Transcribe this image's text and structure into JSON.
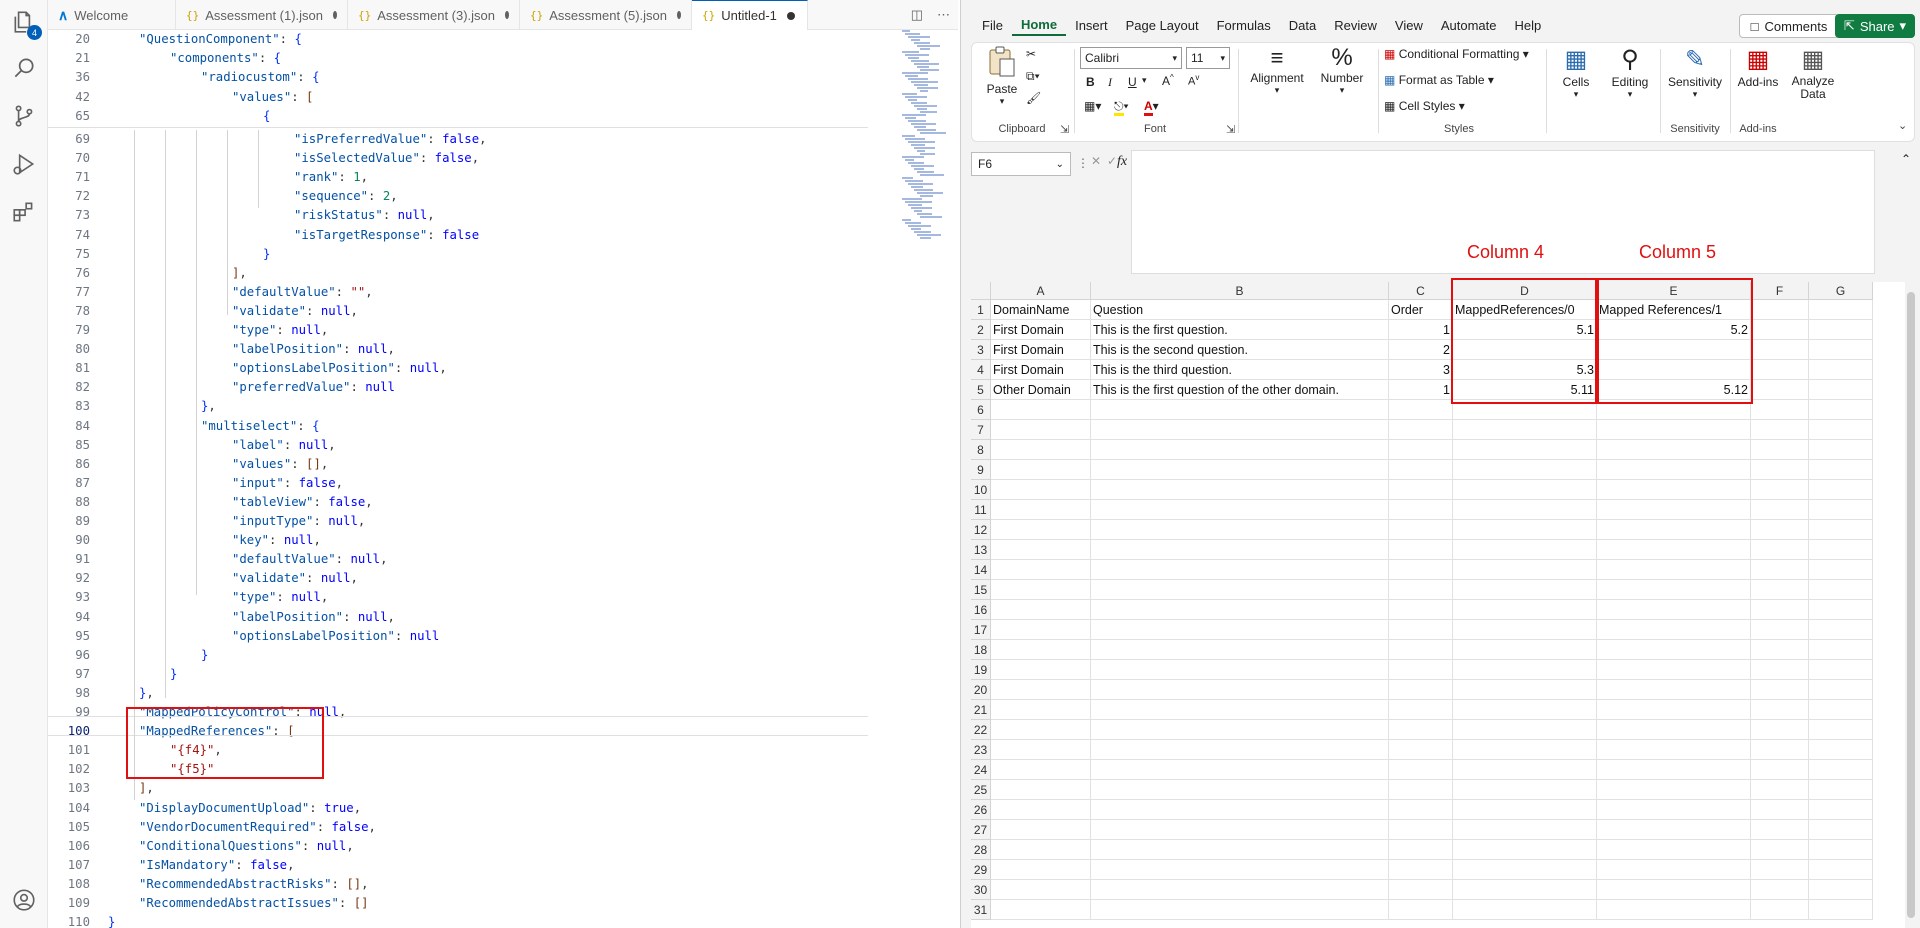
{
  "vscode": {
    "activity_badge": "4",
    "tabs": [
      {
        "label": "Welcome",
        "icon": "vscode-icon",
        "dirty": false
      },
      {
        "label": "Assessment (1).json",
        "icon": "json-icon",
        "dirty": true
      },
      {
        "label": "Assessment (3).json",
        "icon": "json-icon",
        "dirty": true
      },
      {
        "label": "Assessment (5).json",
        "icon": "json-icon",
        "dirty": true
      },
      {
        "label": "Untitled-1",
        "icon": "json-icon",
        "dirty": true,
        "active": true
      }
    ],
    "sticky": [
      {
        "ln": "20",
        "indent": 1,
        "text": "\"QuestionComponent\": {"
      },
      {
        "ln": "21",
        "indent": 2,
        "text": "\"components\": {"
      },
      {
        "ln": "36",
        "indent": 3,
        "text": "\"radiocustom\": {"
      },
      {
        "ln": "42",
        "indent": 4,
        "text": "\"values\": ["
      },
      {
        "ln": "65",
        "indent": 5,
        "text": "{"
      }
    ],
    "lines": [
      {
        "ln": "69",
        "indent": 6,
        "text": "\"isPreferredValue\": false,"
      },
      {
        "ln": "70",
        "indent": 6,
        "text": "\"isSelectedValue\": false,"
      },
      {
        "ln": "71",
        "indent": 6,
        "text": "\"rank\": 1,"
      },
      {
        "ln": "72",
        "indent": 6,
        "text": "\"sequence\": 2,"
      },
      {
        "ln": "73",
        "indent": 6,
        "text": "\"riskStatus\": null,"
      },
      {
        "ln": "74",
        "indent": 6,
        "text": "\"isTargetResponse\": false"
      },
      {
        "ln": "75",
        "indent": 5,
        "text": "}"
      },
      {
        "ln": "76",
        "indent": 4,
        "text": "],"
      },
      {
        "ln": "77",
        "indent": 4,
        "text": "\"defaultValue\": \"\","
      },
      {
        "ln": "78",
        "indent": 4,
        "text": "\"validate\": null,"
      },
      {
        "ln": "79",
        "indent": 4,
        "text": "\"type\": null,"
      },
      {
        "ln": "80",
        "indent": 4,
        "text": "\"labelPosition\": null,"
      },
      {
        "ln": "81",
        "indent": 4,
        "text": "\"optionsLabelPosition\": null,"
      },
      {
        "ln": "82",
        "indent": 4,
        "text": "\"preferredValue\": null"
      },
      {
        "ln": "83",
        "indent": 3,
        "text": "},"
      },
      {
        "ln": "84",
        "indent": 3,
        "text": "\"multiselect\": {"
      },
      {
        "ln": "85",
        "indent": 4,
        "text": "\"label\": null,"
      },
      {
        "ln": "86",
        "indent": 4,
        "text": "\"values\": [],"
      },
      {
        "ln": "87",
        "indent": 4,
        "text": "\"input\": false,"
      },
      {
        "ln": "88",
        "indent": 4,
        "text": "\"tableView\": false,"
      },
      {
        "ln": "89",
        "indent": 4,
        "text": "\"inputType\": null,"
      },
      {
        "ln": "90",
        "indent": 4,
        "text": "\"key\": null,"
      },
      {
        "ln": "91",
        "indent": 4,
        "text": "\"defaultValue\": null,"
      },
      {
        "ln": "92",
        "indent": 4,
        "text": "\"validate\": null,"
      },
      {
        "ln": "93",
        "indent": 4,
        "text": "\"type\": null,"
      },
      {
        "ln": "94",
        "indent": 4,
        "text": "\"labelPosition\": null,"
      },
      {
        "ln": "95",
        "indent": 4,
        "text": "\"optionsLabelPosition\": null"
      },
      {
        "ln": "96",
        "indent": 3,
        "text": "}"
      },
      {
        "ln": "97",
        "indent": 2,
        "text": "}"
      },
      {
        "ln": "98",
        "indent": 1,
        "text": "},"
      },
      {
        "ln": "99",
        "indent": 1,
        "text": "\"MappedPolicyControl\": null,"
      },
      {
        "ln": "100",
        "indent": 1,
        "text": "\"MappedReferences\": [",
        "current": true
      },
      {
        "ln": "101",
        "indent": 2,
        "text": "\"{f4}\","
      },
      {
        "ln": "102",
        "indent": 2,
        "text": "\"{f5}\""
      },
      {
        "ln": "103",
        "indent": 1,
        "text": "],"
      },
      {
        "ln": "104",
        "indent": 1,
        "text": "\"DisplayDocumentUpload\": true,"
      },
      {
        "ln": "105",
        "indent": 1,
        "text": "\"VendorDocumentRequired\": false,"
      },
      {
        "ln": "106",
        "indent": 1,
        "text": "\"ConditionalQuestions\": null,"
      },
      {
        "ln": "107",
        "indent": 1,
        "text": "\"IsMandatory\": false,"
      },
      {
        "ln": "108",
        "indent": 1,
        "text": "\"RecommendedAbstractRisks\": [],"
      },
      {
        "ln": "109",
        "indent": 1,
        "text": "\"RecommendedAbstractIssues\": []"
      },
      {
        "ln": "110",
        "indent": 0,
        "text": "}"
      }
    ]
  },
  "excel": {
    "menu": [
      "File",
      "Home",
      "Insert",
      "Page Layout",
      "Formulas",
      "Data",
      "Review",
      "View",
      "Automate",
      "Help"
    ],
    "selected_menu": "Home",
    "comments_label": "Comments",
    "share_label": "Share",
    "ribbon": {
      "paste": "Paste",
      "clipboard": "Clipboard",
      "font_name": "Calibri",
      "font_size": "11",
      "font": "Font",
      "alignment": "Alignment",
      "number": "Number",
      "conditional_formatting": "Conditional Formatting",
      "format_as_table": "Format as Table",
      "cell_styles": "Cell Styles",
      "styles": "Styles",
      "cells": "Cells",
      "editing": "Editing",
      "sensitivity": "Sensitivity",
      "sensitivity_group": "Sensitivity",
      "addins": "Add-ins",
      "addins_group": "Add-ins",
      "analyze_data": "Analyze Data",
      "bold": "B",
      "italic": "I",
      "underline": "U"
    },
    "name_box": "F6",
    "fx": "fx",
    "annotations": {
      "col4": "Column 4",
      "col5": "Column 5"
    },
    "columns": [
      "A",
      "B",
      "C",
      "D",
      "E",
      "F",
      "G"
    ],
    "rows": [
      [
        "DomainName",
        "Question",
        "Order",
        "MappedReferences/0",
        "Mapped References/1",
        "",
        ""
      ],
      [
        "First Domain",
        "This is the first question.",
        "1",
        "5.1",
        "5.2",
        "",
        ""
      ],
      [
        "First Domain",
        "This is the second question.",
        "2",
        "",
        "",
        "",
        ""
      ],
      [
        "First Domain",
        "This is the third question.",
        "3",
        "5.3",
        "",
        "",
        ""
      ],
      [
        "Other Domain",
        "This is the first question of the other domain.",
        "1",
        "5.11",
        "5.12",
        "",
        ""
      ]
    ],
    "row_count": 31
  },
  "colors": {
    "accent_red": "#e01010",
    "excel_green": "#107c41",
    "vscode_blue": "#005fb8"
  }
}
